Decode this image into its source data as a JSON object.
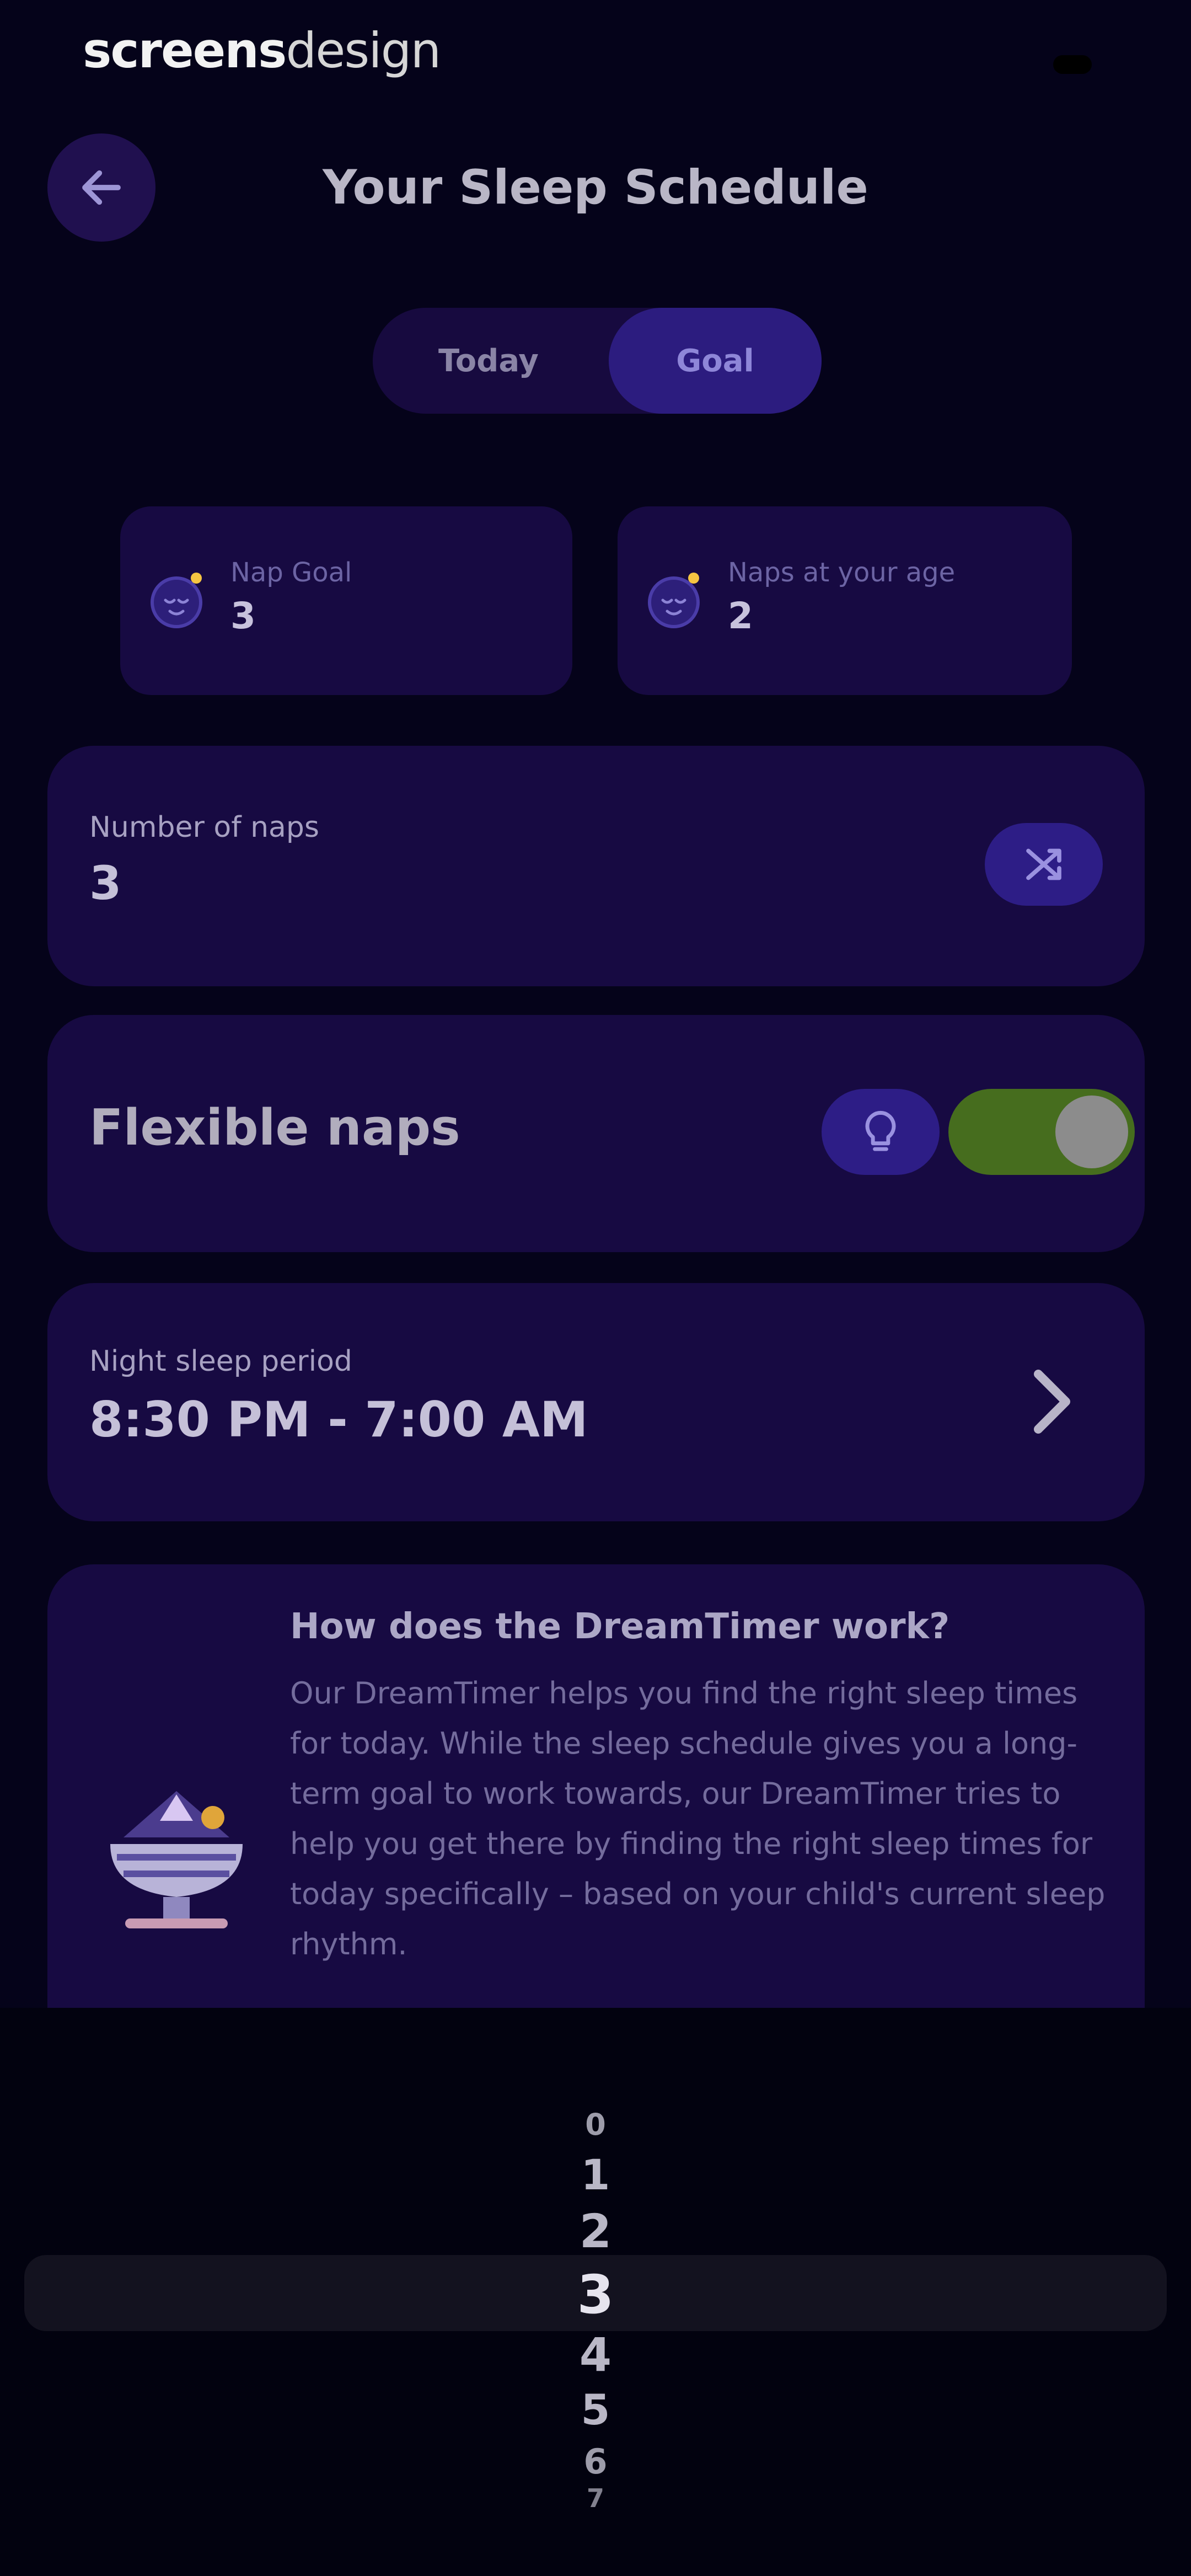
{
  "brand": {
    "part1": "screens",
    "part2": "design"
  },
  "header": {
    "title": "Your Sleep Schedule",
    "back_icon": "arrow-left-icon"
  },
  "tabs": [
    {
      "label": "Today",
      "selected": false
    },
    {
      "label": "Goal",
      "selected": true
    }
  ],
  "stats": [
    {
      "label": "Nap Goal",
      "value": "3",
      "icon": "moon-face-icon"
    },
    {
      "label": "Naps at your age",
      "value": "2",
      "icon": "moon-face-icon"
    }
  ],
  "naps": {
    "label": "Number of naps",
    "value": "3",
    "icon": "shuffle-icon"
  },
  "flexible": {
    "label": "Flexible naps",
    "enabled": true,
    "tip_icon": "lightbulb-icon"
  },
  "night": {
    "label": "Night sleep period",
    "value": "8:30 PM - 7:00 AM",
    "icon": "chevron-right-icon"
  },
  "info": {
    "title": "How does the DreamTimer work?",
    "body": "Our DreamTimer helps you find the right sleep times for today. While the sleep schedule gives you a long-term goal to work towards, our DreamTimer tries to help you get there by finding the right sleep times for today specifically – based on your child's current sleep rhythm."
  },
  "picker": {
    "options": [
      "0",
      "1",
      "2",
      "3",
      "4",
      "5",
      "6",
      "7"
    ],
    "selected": "3"
  },
  "colors": {
    "background": "#05031a",
    "card": "#170a42",
    "accent": "#2c1c7f",
    "toggle_on": "#466d1e"
  }
}
